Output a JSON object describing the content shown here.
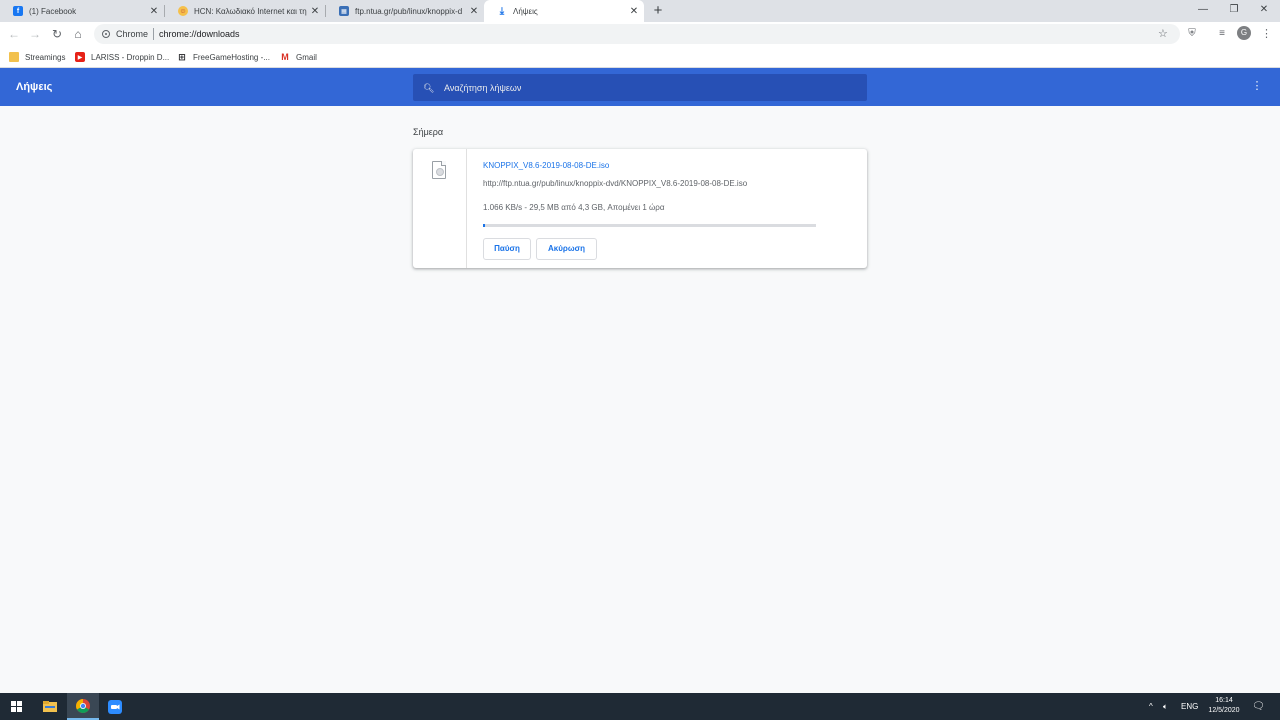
{
  "browser": {
    "tabs": [
      {
        "title": "(1) Facebook",
        "icon": "facebook-icon",
        "active": false
      },
      {
        "title": "HCN: Καλωδιακό Internet και τη",
        "icon": "hcn-icon",
        "active": false
      },
      {
        "title": "ftp.ntua.gr/pub/linux/knoppix-d",
        "icon": "ftp-folder-icon",
        "active": false
      },
      {
        "title": "Λήψεις",
        "icon": "download-icon",
        "active": true
      }
    ],
    "omnibox": {
      "chip": "Chrome",
      "url": "chrome://downloads"
    },
    "bookmarks": [
      {
        "label": "Streamings",
        "icon": "folder-icon"
      },
      {
        "label": "LARISS - Droppin D...",
        "icon": "youtube-icon"
      },
      {
        "label": "FreeGameHosting -...",
        "icon": "freegamehosting-icon"
      },
      {
        "label": "Gmail",
        "icon": "gmail-icon"
      }
    ],
    "avatar_letter": "G"
  },
  "downloads": {
    "title": "Λήψεις",
    "search_placeholder": "Αναζήτηση λήψεων",
    "section": "Σήμερα",
    "item": {
      "filename": "KNOPPIX_V8.6-2019-08-08-DE.iso",
      "url": "http://ftp.ntua.gr/pub/linux/knoppix-dvd/KNOPPIX_V8.6-2019-08-08-DE.iso",
      "status": "1.066 KB/s - 29,5 MB από 4,3 GB, Απομένει 1 ώρα",
      "progress_fraction": 0.007,
      "pause_label": "Παύση",
      "cancel_label": "Ακύρωση"
    }
  },
  "taskbar": {
    "language": "ENG",
    "time": "16:14",
    "date": "12/5/2020"
  },
  "colors": {
    "header": "#3367d6",
    "accent": "#1a73e8",
    "taskbar": "#1f2a35"
  }
}
